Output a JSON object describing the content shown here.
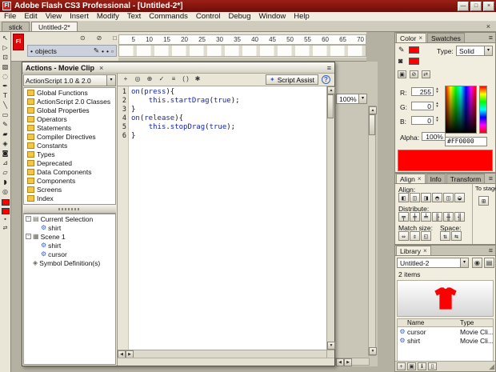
{
  "window": {
    "title": "Adobe Flash CS3 Professional - [Untitled-2*]",
    "app_icon_text": "Fl"
  },
  "menu_bar": {
    "items": [
      "File",
      "Edit",
      "View",
      "Insert",
      "Modify",
      "Text",
      "Commands",
      "Control",
      "Debug",
      "Window",
      "Help"
    ]
  },
  "document_tabs": [
    {
      "label": "stick",
      "active": false
    },
    {
      "label": "Untitled-2*",
      "active": true
    }
  ],
  "tools": [
    "selection",
    "subselection",
    "free-transform",
    "gradient-transform",
    "lasso",
    "pen",
    "text",
    "line",
    "rectangle",
    "pencil",
    "brush",
    "ink-bottle",
    "paint-bucket",
    "eyedropper",
    "eraser",
    "hand",
    "zoom"
  ],
  "timeline": {
    "app_badge": "Fl",
    "layer_name": "objects",
    "ruler_numbers": [
      "5",
      "10",
      "15",
      "20",
      "25",
      "30",
      "35",
      "40",
      "45",
      "50",
      "55",
      "60",
      "65",
      "70"
    ]
  },
  "stage": {
    "zoom_level": "100%"
  },
  "actions_panel": {
    "title": "Actions - Movie Clip",
    "language": "ActionScript 1.0 & 2.0",
    "script_assist_label": "Script Assist",
    "toolbox_items": [
      "Global Functions",
      "ActionScript 2.0 Classes",
      "Global Properties",
      "Operators",
      "Statements",
      "Compiler Directives",
      "Constants",
      "Types",
      "Deprecated",
      "Data Components",
      "Components",
      "Screens",
      "Index"
    ],
    "navigator_items": [
      {
        "label": "Current Selection",
        "indent": 0,
        "icon": "document",
        "expanded": true
      },
      {
        "label": "shirt",
        "indent": 1,
        "icon": "movieclip"
      },
      {
        "label": "Scene 1",
        "indent": 0,
        "icon": "scene",
        "expanded": true
      },
      {
        "label": "shirt",
        "indent": 1,
        "icon": "movieclip"
      },
      {
        "label": "cursor",
        "indent": 1,
        "icon": "movieclip"
      },
      {
        "label": "Symbol Definition(s)",
        "indent": 0,
        "icon": "symbol"
      }
    ],
    "code_lines": [
      {
        "n": 1,
        "tokens": [
          [
            "on",
            "k"
          ],
          [
            "(",
            "p"
          ],
          [
            "press",
            "k"
          ],
          [
            "){",
            "p"
          ]
        ]
      },
      {
        "n": 2,
        "tokens": [
          [
            "    ",
            "p"
          ],
          [
            "this",
            "k"
          ],
          [
            ".",
            "p"
          ],
          [
            "startDrag",
            "k"
          ],
          [
            "(",
            "p"
          ],
          [
            "true",
            "k"
          ],
          [
            ");",
            "p"
          ]
        ]
      },
      {
        "n": 3,
        "tokens": [
          [
            "}",
            "p"
          ]
        ]
      },
      {
        "n": 4,
        "tokens": [
          [
            "on",
            "k"
          ],
          [
            "(",
            "p"
          ],
          [
            "release",
            "k"
          ],
          [
            "){",
            "p"
          ]
        ]
      },
      {
        "n": 5,
        "tokens": [
          [
            "    ",
            "p"
          ],
          [
            "this",
            "k"
          ],
          [
            ".",
            "p"
          ],
          [
            "stopDrag",
            "k"
          ],
          [
            "(",
            "p"
          ],
          [
            "true",
            "k"
          ],
          [
            ");",
            "p"
          ]
        ]
      },
      {
        "n": 6,
        "tokens": [
          [
            "}",
            "p"
          ]
        ]
      }
    ]
  },
  "color_panel": {
    "tabs": [
      "Color",
      "Swatches"
    ],
    "type_label": "Type:",
    "type_value": "Solid",
    "r_label": "R:",
    "r_value": "255",
    "g_label": "G:",
    "g_value": "0",
    "b_label": "B:",
    "b_value": "0",
    "alpha_label": "Alpha:",
    "alpha_value": "100%",
    "hex_value": "#FF0000",
    "current_color": "#FF0000"
  },
  "align_panel": {
    "tabs": [
      "Align",
      "Info",
      "Transform"
    ],
    "align_label": "Align:",
    "distribute_label": "Distribute:",
    "match_label": "Match size:",
    "space_label": "Space:",
    "to_stage_label": "To stage:"
  },
  "library_panel": {
    "tab": "Library",
    "document_name": "Untitled-2",
    "items_count": "2 items",
    "columns": [
      "Name",
      "Type"
    ],
    "rows": [
      {
        "name": "cursor",
        "type": "Movie Cli..."
      },
      {
        "name": "shirt",
        "type": "Movie Cli..."
      }
    ]
  }
}
